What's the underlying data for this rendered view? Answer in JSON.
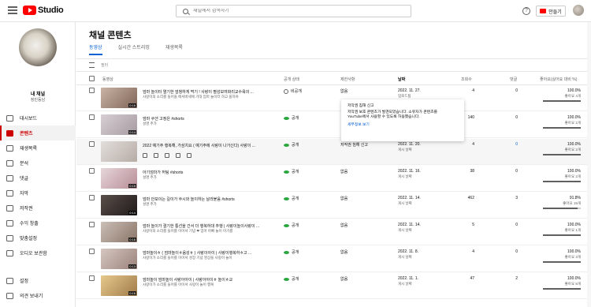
{
  "topbar": {
    "logo_text": "Studio",
    "search_placeholder": "채널에서 검색하기",
    "help_label": "?",
    "create_label": "만들기"
  },
  "sidebar": {
    "channel_title": "내 채널",
    "channel_sub": "정민동남",
    "items": [
      {
        "label": "대시보드",
        "active": false
      },
      {
        "label": "콘텐츠",
        "active": true
      },
      {
        "label": "재생목록",
        "active": false
      },
      {
        "label": "분석",
        "active": false
      },
      {
        "label": "댓글",
        "active": false
      },
      {
        "label": "자막",
        "active": false
      },
      {
        "label": "저작권",
        "active": false
      },
      {
        "label": "수익 창출",
        "active": false
      },
      {
        "label": "맞춤설정",
        "active": false
      },
      {
        "label": "오디오 보관함",
        "active": false
      }
    ],
    "bottom_items": [
      {
        "label": "설정"
      },
      {
        "label": "의견 보내기"
      }
    ]
  },
  "main": {
    "title": "채널 콘텐츠",
    "tabs": [
      {
        "label": "동영상",
        "active": true
      },
      {
        "label": "실시간 스트리밍",
        "active": false
      },
      {
        "label": "재생목록",
        "active": false
      }
    ],
    "filter_placeholder": "필터",
    "headers": {
      "video": "동영상",
      "visibility": "공개 상태",
      "restrictions": "제한사항",
      "date": "날짜",
      "views": "조회수",
      "comments": "댓글",
      "likes": "좋아요(싫어요 대비 %)"
    }
  },
  "rows": [
    {
      "title": "엄마 놀이터 열기한 엄청하게 먹기 ! 사랑이 펼성보여화리교수욕의 ...",
      "desc": "사랑이의 소리를 들어올 에서버세에 기대 엄마 놀이터 하고 올하야",
      "duration": "0:16",
      "visibility": "비공개",
      "visibility_type": "private",
      "restriction": "없음",
      "date": "2022. 11. 27.",
      "date_sub": "업로드됨",
      "views": "4",
      "comments": "0",
      "ratio": "100.0%",
      "ratio_sub": "좋아요 4개",
      "ratio_value": 1.0,
      "thumb": [
        "#c9b3a4",
        "#7f6559"
      ]
    },
    {
      "title": "엄마 쿠션 고정은 #shorts",
      "desc": "설명 추가",
      "duration": "0:14",
      "visibility": "공개",
      "visibility_type": "public",
      "restriction": "",
      "date": "",
      "date_sub": "",
      "views": "140",
      "comments": "0",
      "ratio": "100.0%",
      "ratio_sub": "좋아요 2개",
      "ratio_value": 1.0,
      "thumb": [
        "#d7cfd3",
        "#a59aa1"
      ]
    },
    {
      "title": "2022 예기주 행복해, 가삼치요 ( 예기주에 사랑이 나가신다) 사랑이 ...",
      "desc": "",
      "duration": "",
      "visibility": "공개",
      "visibility_type": "public",
      "restriction": "저작권 침해 신고",
      "date": "2022. 11. 20.",
      "date_sub": "게시 날짜",
      "views": "4",
      "comments": "0",
      "ratio": "100.0%",
      "ratio_sub": "좋아요 2개",
      "ratio_value": 1.0,
      "thumb": [
        "#e2dedb",
        "#b7aca6"
      ]
    },
    {
      "title": "아기엄마가 허팅 #shorts",
      "desc": "설명 추가",
      "duration": "0:15",
      "visibility": "공개",
      "visibility_type": "public",
      "restriction": "없음",
      "date": "2022. 11. 16.",
      "date_sub": "게시 날짜",
      "views": "38",
      "comments": "0",
      "ratio": "100.0%",
      "ratio_sub": "좋아요 2개",
      "ratio_value": 1.0,
      "thumb": [
        "#e5d6da",
        "#b88c95"
      ]
    },
    {
      "title": "엄마 안보이는 길이가 쑤시와 놀이하는 날라붙음 #shorts",
      "desc": "설명 추가",
      "duration": "0:14",
      "visibility": "공개",
      "visibility_type": "public",
      "restriction": "없음",
      "date": "2022. 11. 14.",
      "date_sub": "게시 날짜",
      "views": "462",
      "comments": "3",
      "ratio": "91.8%",
      "ratio_sub": "좋아요 19개",
      "ratio_value": 0.918,
      "thumb": [
        "#5a4e4a",
        "#1f1a19"
      ]
    },
    {
      "title": "엄마 놀이가 결기한 통선을 간서 더 행복하대 추행 | 사랑이놀이사랑이 ...",
      "desc": "사랑이의 소리를 들어를 이어서 기념 ❤ 엄마 아빠 놀이 아기를",
      "duration": "0:16",
      "visibility": "공개",
      "visibility_type": "public",
      "restriction": "없음",
      "date": "2022. 11. 14.",
      "date_sub": "게시 날짜",
      "views": "5",
      "comments": "0",
      "ratio": "100.0%",
      "ratio_sub": "좋아요 1개",
      "ratio_value": 1.0,
      "thumb": [
        "#cbbfb6",
        "#8a7468"
      ]
    },
    {
      "title": "엄마놀이ㅎ ( 엄마놀이ㅎ음성ㅎ ) 사랑이아이 | 사랑이행복하ㅎ고 ...",
      "desc": "사랑이가 소리를 들어를 이어서 성장 기념 영상을 사랑이 놀이",
      "duration": "0:13",
      "visibility": "공개",
      "visibility_type": "public",
      "restriction": "없음",
      "date": "2022. 11. 8.",
      "date_sub": "게시 날짜",
      "views": "4",
      "comments": "0",
      "ratio": "100.0%",
      "ratio_sub": "좋아요 3개",
      "ratio_value": 1.0,
      "thumb": [
        "#d6c7c2",
        "#9b827a"
      ]
    },
    {
      "title": "엄마놀이 엄마놀이 사랑아아이 | 사랑아아이ㅎ 놀이ㅎ교",
      "desc": "사랑이가 소리를 들어를 아이서 사랑이 놀이 행복",
      "duration": "0:16",
      "visibility": "공개",
      "visibility_type": "public",
      "restriction": "없음",
      "date": "2022. 11. 1.",
      "date_sub": "게시 날짜",
      "views": "47",
      "comments": "2",
      "ratio": "100.0%",
      "ratio_sub": "좋아요 8개",
      "ratio_value": 1.0,
      "thumb": [
        "#e6c98c",
        "#a07a4a"
      ]
    }
  ],
  "popup": {
    "title": "저작권 침해 신고",
    "line1": "저작권 보호 콘텐츠가 발견되었습니다. 소유자가 콘텐츠를",
    "line2": "YouTube에서 사용할 수 있도록 허용했습니다.",
    "link": "세부정보 보기"
  },
  "colors": {
    "accent": "#065fd4",
    "brand": "#ff0000",
    "active_nav": "#cc0000",
    "public": "#2ba640"
  }
}
